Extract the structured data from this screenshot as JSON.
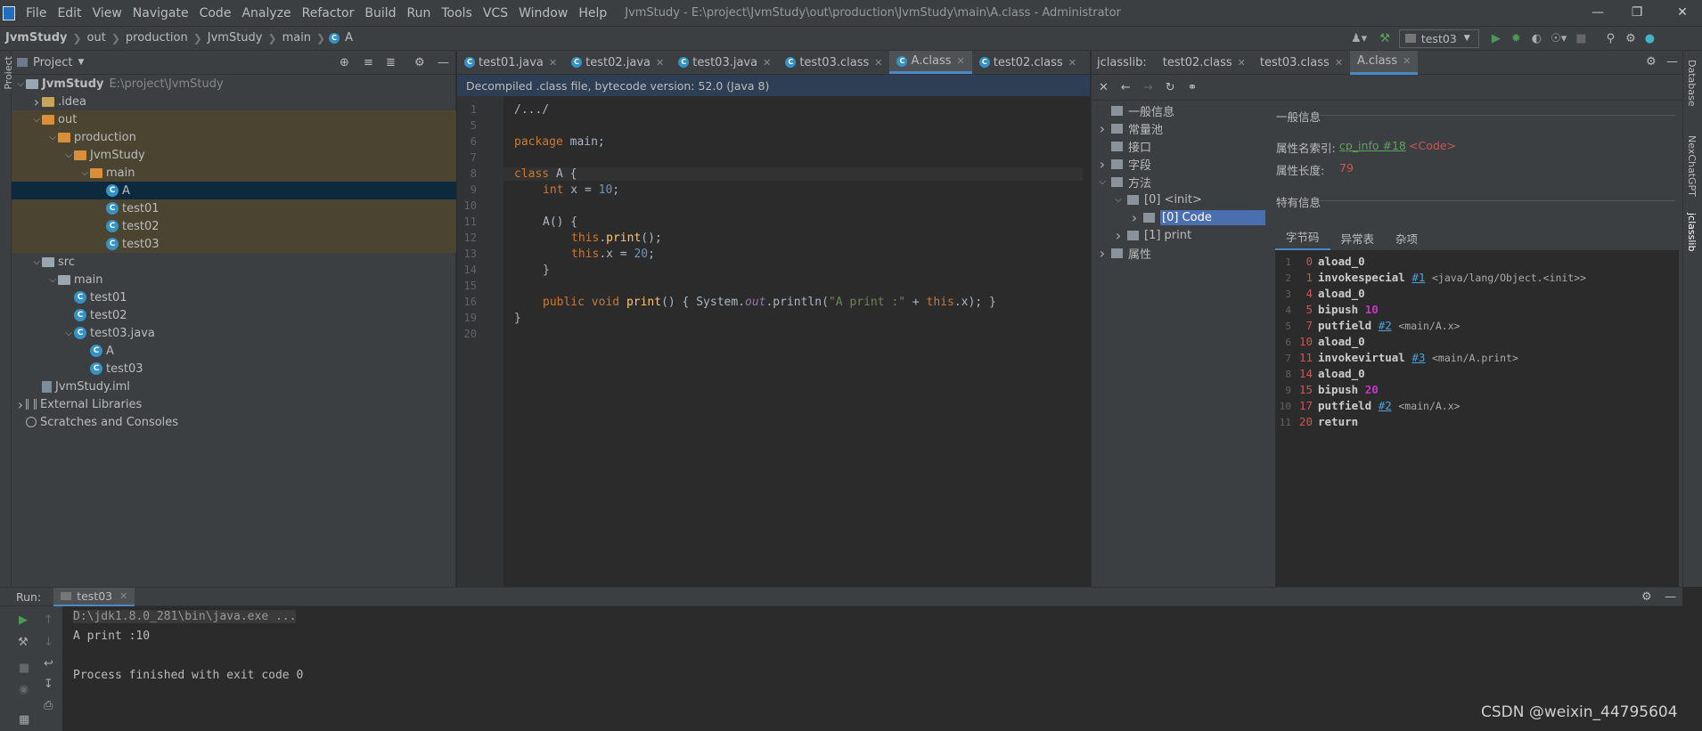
{
  "titlebar": {
    "menus": [
      "File",
      "Edit",
      "View",
      "Navigate",
      "Code",
      "Analyze",
      "Refactor",
      "Build",
      "Run",
      "Tools",
      "VCS",
      "Window",
      "Help"
    ],
    "title": "JvmStudy - E:\\project\\JvmStudy\\out\\production\\JvmStudy\\main\\A.class - Administrator"
  },
  "breadcrumb": [
    "JvmStudy",
    "out",
    "production",
    "JvmStudy",
    "main",
    "A"
  ],
  "run_config": "test03",
  "left_strip": "Project",
  "right_strip": [
    "Database",
    "NexChatGPT",
    "jclasslib"
  ],
  "project": {
    "header": "Project",
    "tree": [
      {
        "label": "JvmStudy",
        "path": "E:\\project\\JvmStudy"
      },
      {
        "label": ".idea"
      },
      {
        "label": "out"
      },
      {
        "label": "production"
      },
      {
        "label": "JvmStudy"
      },
      {
        "label": "main"
      },
      {
        "label": "A"
      },
      {
        "label": "test01"
      },
      {
        "label": "test02"
      },
      {
        "label": "test03"
      },
      {
        "label": "src"
      },
      {
        "label": "main"
      },
      {
        "label": "test01"
      },
      {
        "label": "test02"
      },
      {
        "label": "test03.java"
      },
      {
        "label": "A"
      },
      {
        "label": "test03"
      },
      {
        "label": "JvmStudy.iml"
      },
      {
        "label": "External Libraries"
      },
      {
        "label": "Scratches and Consoles"
      }
    ]
  },
  "editor": {
    "tabs": [
      "test01.java",
      "test02.java",
      "test03.java",
      "test03.class",
      "A.class",
      "test02.class"
    ],
    "active_tab": "A.class",
    "banner": "Decompiled .class file, bytecode version: 52.0 (Java 8)",
    "line_numbers": [
      "1",
      "5",
      "6",
      "7",
      "8",
      "9",
      "10",
      "11",
      "12",
      "13",
      "14",
      "15",
      "16",
      "19",
      "20"
    ],
    "lines": [
      "/.../",
      "",
      "package main;",
      "",
      "class A {",
      "int x = 10;",
      "",
      "A() {",
      "this.print();",
      "this.x = 20;",
      "}",
      "",
      "public void print() { System.out.println(\"A print :\" + this.x); }",
      "}",
      ""
    ]
  },
  "jclasslib": {
    "label": "jclasslib:",
    "tabs": [
      "test02.class",
      "test03.class",
      "A.class"
    ],
    "tree": [
      "一般信息",
      "常量池",
      "接口",
      "字段",
      "方法",
      "[0] <init>",
      "[0] Code",
      "[1] print",
      "属性"
    ],
    "general_header": "一般信息",
    "attr_name_label": "属性名索引:",
    "attr_name_ref": "cp_info #18",
    "attr_name_val": "<Code>",
    "attr_len_label": "属性长度:",
    "attr_len_val": "79",
    "specific_header": "特有信息",
    "subtabs": [
      "字节码",
      "异常表",
      "杂项"
    ],
    "bytecode": [
      {
        "n": "1",
        "off": "0",
        "op": "aload_0",
        "ref": "",
        "cm": "",
        "num": ""
      },
      {
        "n": "2",
        "off": "1",
        "op": "invokespecial",
        "ref": "#1",
        "cm": "<java/lang/Object.<init>>",
        "num": ""
      },
      {
        "n": "3",
        "off": "4",
        "op": "aload_0",
        "ref": "",
        "cm": "",
        "num": ""
      },
      {
        "n": "4",
        "off": "5",
        "op": "bipush",
        "ref": "",
        "cm": "",
        "num": "10"
      },
      {
        "n": "5",
        "off": "7",
        "op": "putfield",
        "ref": "#2",
        "cm": "<main/A.x>",
        "num": ""
      },
      {
        "n": "6",
        "off": "10",
        "op": "aload_0",
        "ref": "",
        "cm": "",
        "num": ""
      },
      {
        "n": "7",
        "off": "11",
        "op": "invokevirtual",
        "ref": "#3",
        "cm": "<main/A.print>",
        "num": ""
      },
      {
        "n": "8",
        "off": "14",
        "op": "aload_0",
        "ref": "",
        "cm": "",
        "num": ""
      },
      {
        "n": "9",
        "off": "15",
        "op": "bipush",
        "ref": "",
        "cm": "",
        "num": "20"
      },
      {
        "n": "10",
        "off": "17",
        "op": "putfield",
        "ref": "#2",
        "cm": "<main/A.x>",
        "num": ""
      },
      {
        "n": "11",
        "off": "20",
        "op": "return",
        "ref": "",
        "cm": "",
        "num": ""
      }
    ]
  },
  "run": {
    "label": "Run:",
    "tab": "test03",
    "output": [
      "D:\\jdk1.8.0_281\\bin\\java.exe ...",
      "A print :10",
      "",
      "Process finished with exit code 0"
    ]
  },
  "watermark": "CSDN @weixin_44795604"
}
